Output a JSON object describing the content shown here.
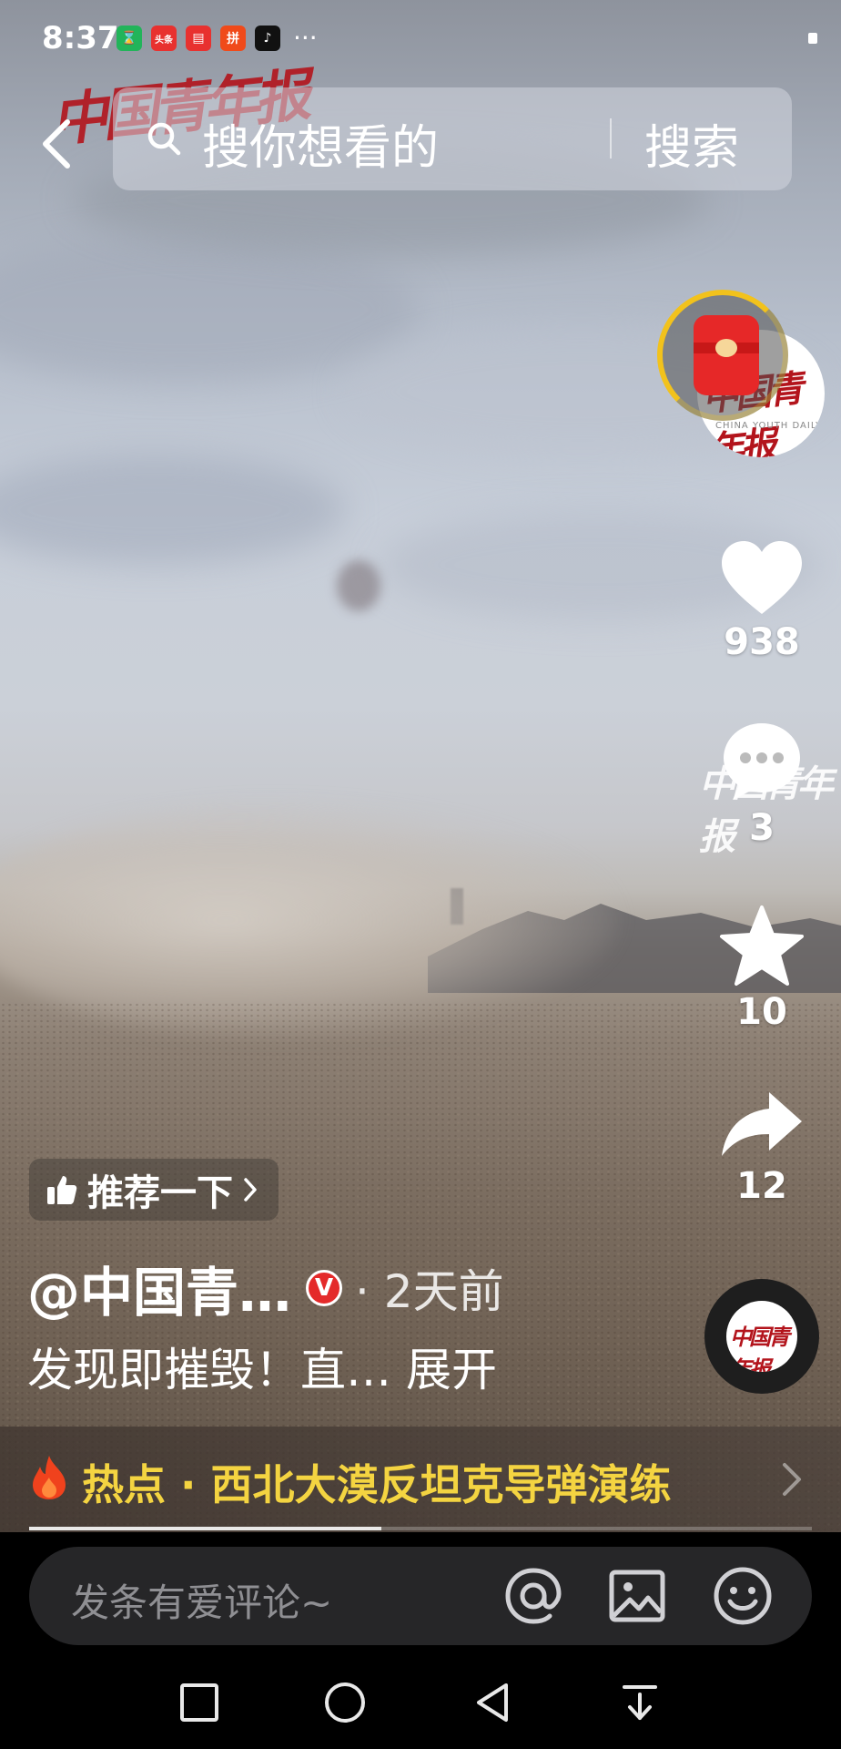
{
  "status_bar": {
    "time": "8:37",
    "app_icons": [
      {
        "name": "hourglass-app-icon",
        "color": "#22b45a",
        "label": "⌛"
      },
      {
        "name": "toutiao-app-icon",
        "color": "#e8312f",
        "label": "头条"
      },
      {
        "name": "book-app-icon",
        "color": "#e8312f",
        "label": "▤"
      },
      {
        "name": "shop-app-icon",
        "color": "#f04a1a",
        "label": "拼"
      },
      {
        "name": "douyin-app-icon",
        "color": "#111111",
        "label": "♪"
      }
    ],
    "more": "···"
  },
  "watermark_logo": "中国青年报",
  "search": {
    "placeholder": "搜你想看的",
    "button_label": "搜索"
  },
  "account": {
    "avatar_logo": "中国青年报",
    "avatar_sub": "CHINA YOUTH DAILY"
  },
  "actions": {
    "like_count": "938",
    "comment_count": "3",
    "favorite_count": "10",
    "share_count": "12"
  },
  "comment_watermark": "中国青年报",
  "video_info": {
    "recommend_label": "推荐一下",
    "author": "@中国青…",
    "verified_badge": "V",
    "time_ago": "· 2天前",
    "caption": "发现即摧毁！直…",
    "expand_label": "展开"
  },
  "hot_topic": {
    "text": "热点 · 西北大漠反坦克导弹演练",
    "text_color": "#f4d441"
  },
  "playback": {
    "progress_fraction": 0.45
  },
  "comment_bar": {
    "placeholder": "发条有爱评论~"
  },
  "disc_logo": "中国青年报",
  "colors": {
    "accent_red": "#e42a2a",
    "ring_yellow": "#f2c21c",
    "hot_yellow": "#f4d441"
  }
}
